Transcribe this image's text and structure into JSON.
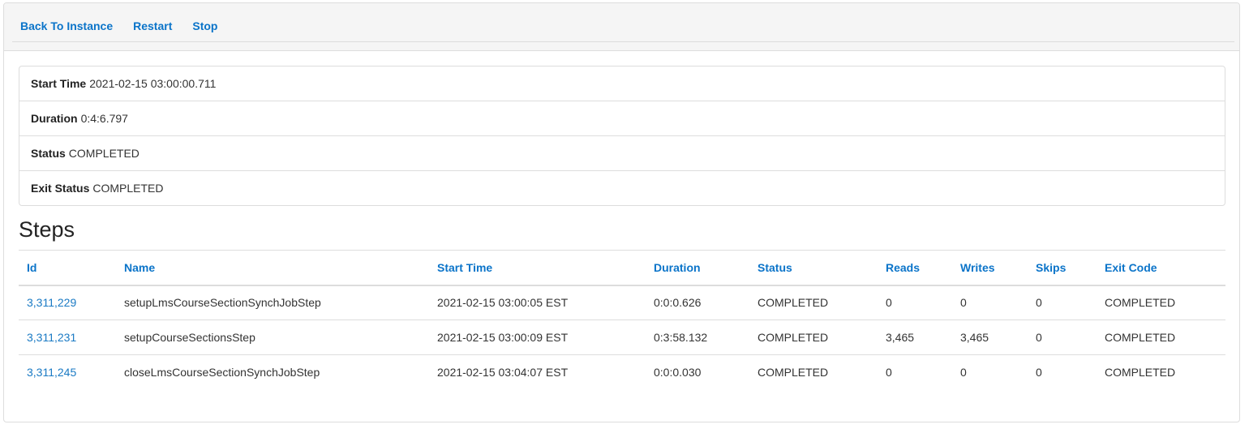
{
  "nav": {
    "back_label": "Back To Instance",
    "restart_label": "Restart",
    "stop_label": "Stop"
  },
  "info": {
    "start_time_label": "Start Time",
    "start_time_value": "2021-02-15 03:00:00.711",
    "duration_label": "Duration",
    "duration_value": "0:4:6.797",
    "status_label": "Status",
    "status_value": "COMPLETED",
    "exit_status_label": "Exit Status",
    "exit_status_value": "COMPLETED"
  },
  "steps": {
    "title": "Steps",
    "columns": [
      "Id",
      "Name",
      "Start Time",
      "Duration",
      "Status",
      "Reads",
      "Writes",
      "Skips",
      "Exit Code"
    ],
    "rows": [
      {
        "id": "3,311,229",
        "name": "setupLmsCourseSectionSynchJobStep",
        "start_time": "2021-02-15 03:00:05 EST",
        "duration": "0:0:0.626",
        "status": "COMPLETED",
        "reads": "0",
        "writes": "0",
        "skips": "0",
        "exit_code": "COMPLETED"
      },
      {
        "id": "3,311,231",
        "name": "setupCourseSectionsStep",
        "start_time": "2021-02-15 03:00:09 EST",
        "duration": "0:3:58.132",
        "status": "COMPLETED",
        "reads": "3,465",
        "writes": "3,465",
        "skips": "0",
        "exit_code": "COMPLETED"
      },
      {
        "id": "3,311,245",
        "name": "closeLmsCourseSectionSynchJobStep",
        "start_time": "2021-02-15 03:04:07 EST",
        "duration": "0:0:0.030",
        "status": "COMPLETED",
        "reads": "0",
        "writes": "0",
        "skips": "0",
        "exit_code": "COMPLETED"
      }
    ]
  },
  "colors": {
    "link": "#0b74c9",
    "border": "#dddddd",
    "heading_bg": "#f5f5f5"
  }
}
